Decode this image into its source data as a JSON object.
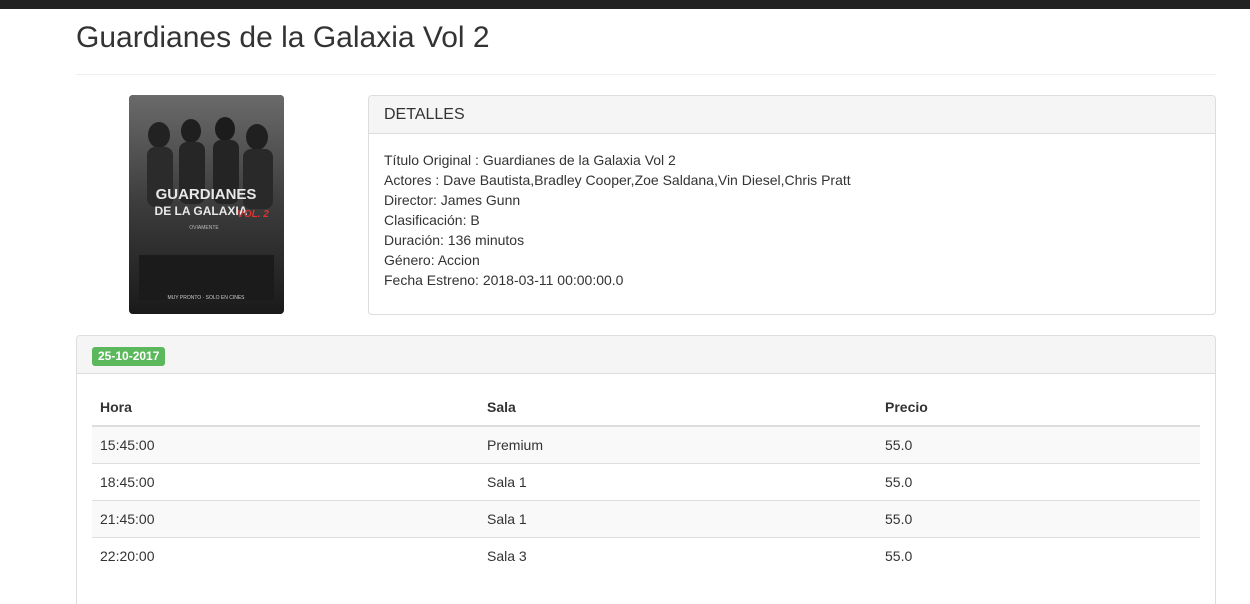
{
  "movie": {
    "title": "Guardianes de la Galaxia Vol 2",
    "poster": {
      "logo_text_line1": "GUARDIANES",
      "logo_text_line2": "DE LA GALAXIA",
      "logo_text_vol": "VOL. 2",
      "tagline": "OVIAMENTE",
      "footer_text": "MUY PRONTO · SOLO EN CINES"
    }
  },
  "details": {
    "heading": "DETALLES",
    "lines": [
      "Título Original : Guardianes de la Galaxia Vol 2",
      "Actores : Dave Bautista,Bradley Cooper,Zoe Saldana,Vin Diesel,Chris Pratt",
      "Director: James Gunn",
      "Clasificación: B",
      "Duración: 136 minutos",
      "Género: Accion",
      "Fecha Estreno: 2018-03-11 00:00:00.0"
    ]
  },
  "showtimes": {
    "date_badge": "25-10-2017",
    "badge_color": "#5cb85c",
    "columns": [
      "Hora",
      "Sala",
      "Precio"
    ],
    "rows": [
      [
        "15:45:00",
        "Premium",
        "55.0"
      ],
      [
        "18:45:00",
        "Sala 1",
        "55.0"
      ],
      [
        "21:45:00",
        "Sala 1",
        "55.0"
      ],
      [
        "22:20:00",
        "Sala 3",
        "55.0"
      ]
    ]
  }
}
